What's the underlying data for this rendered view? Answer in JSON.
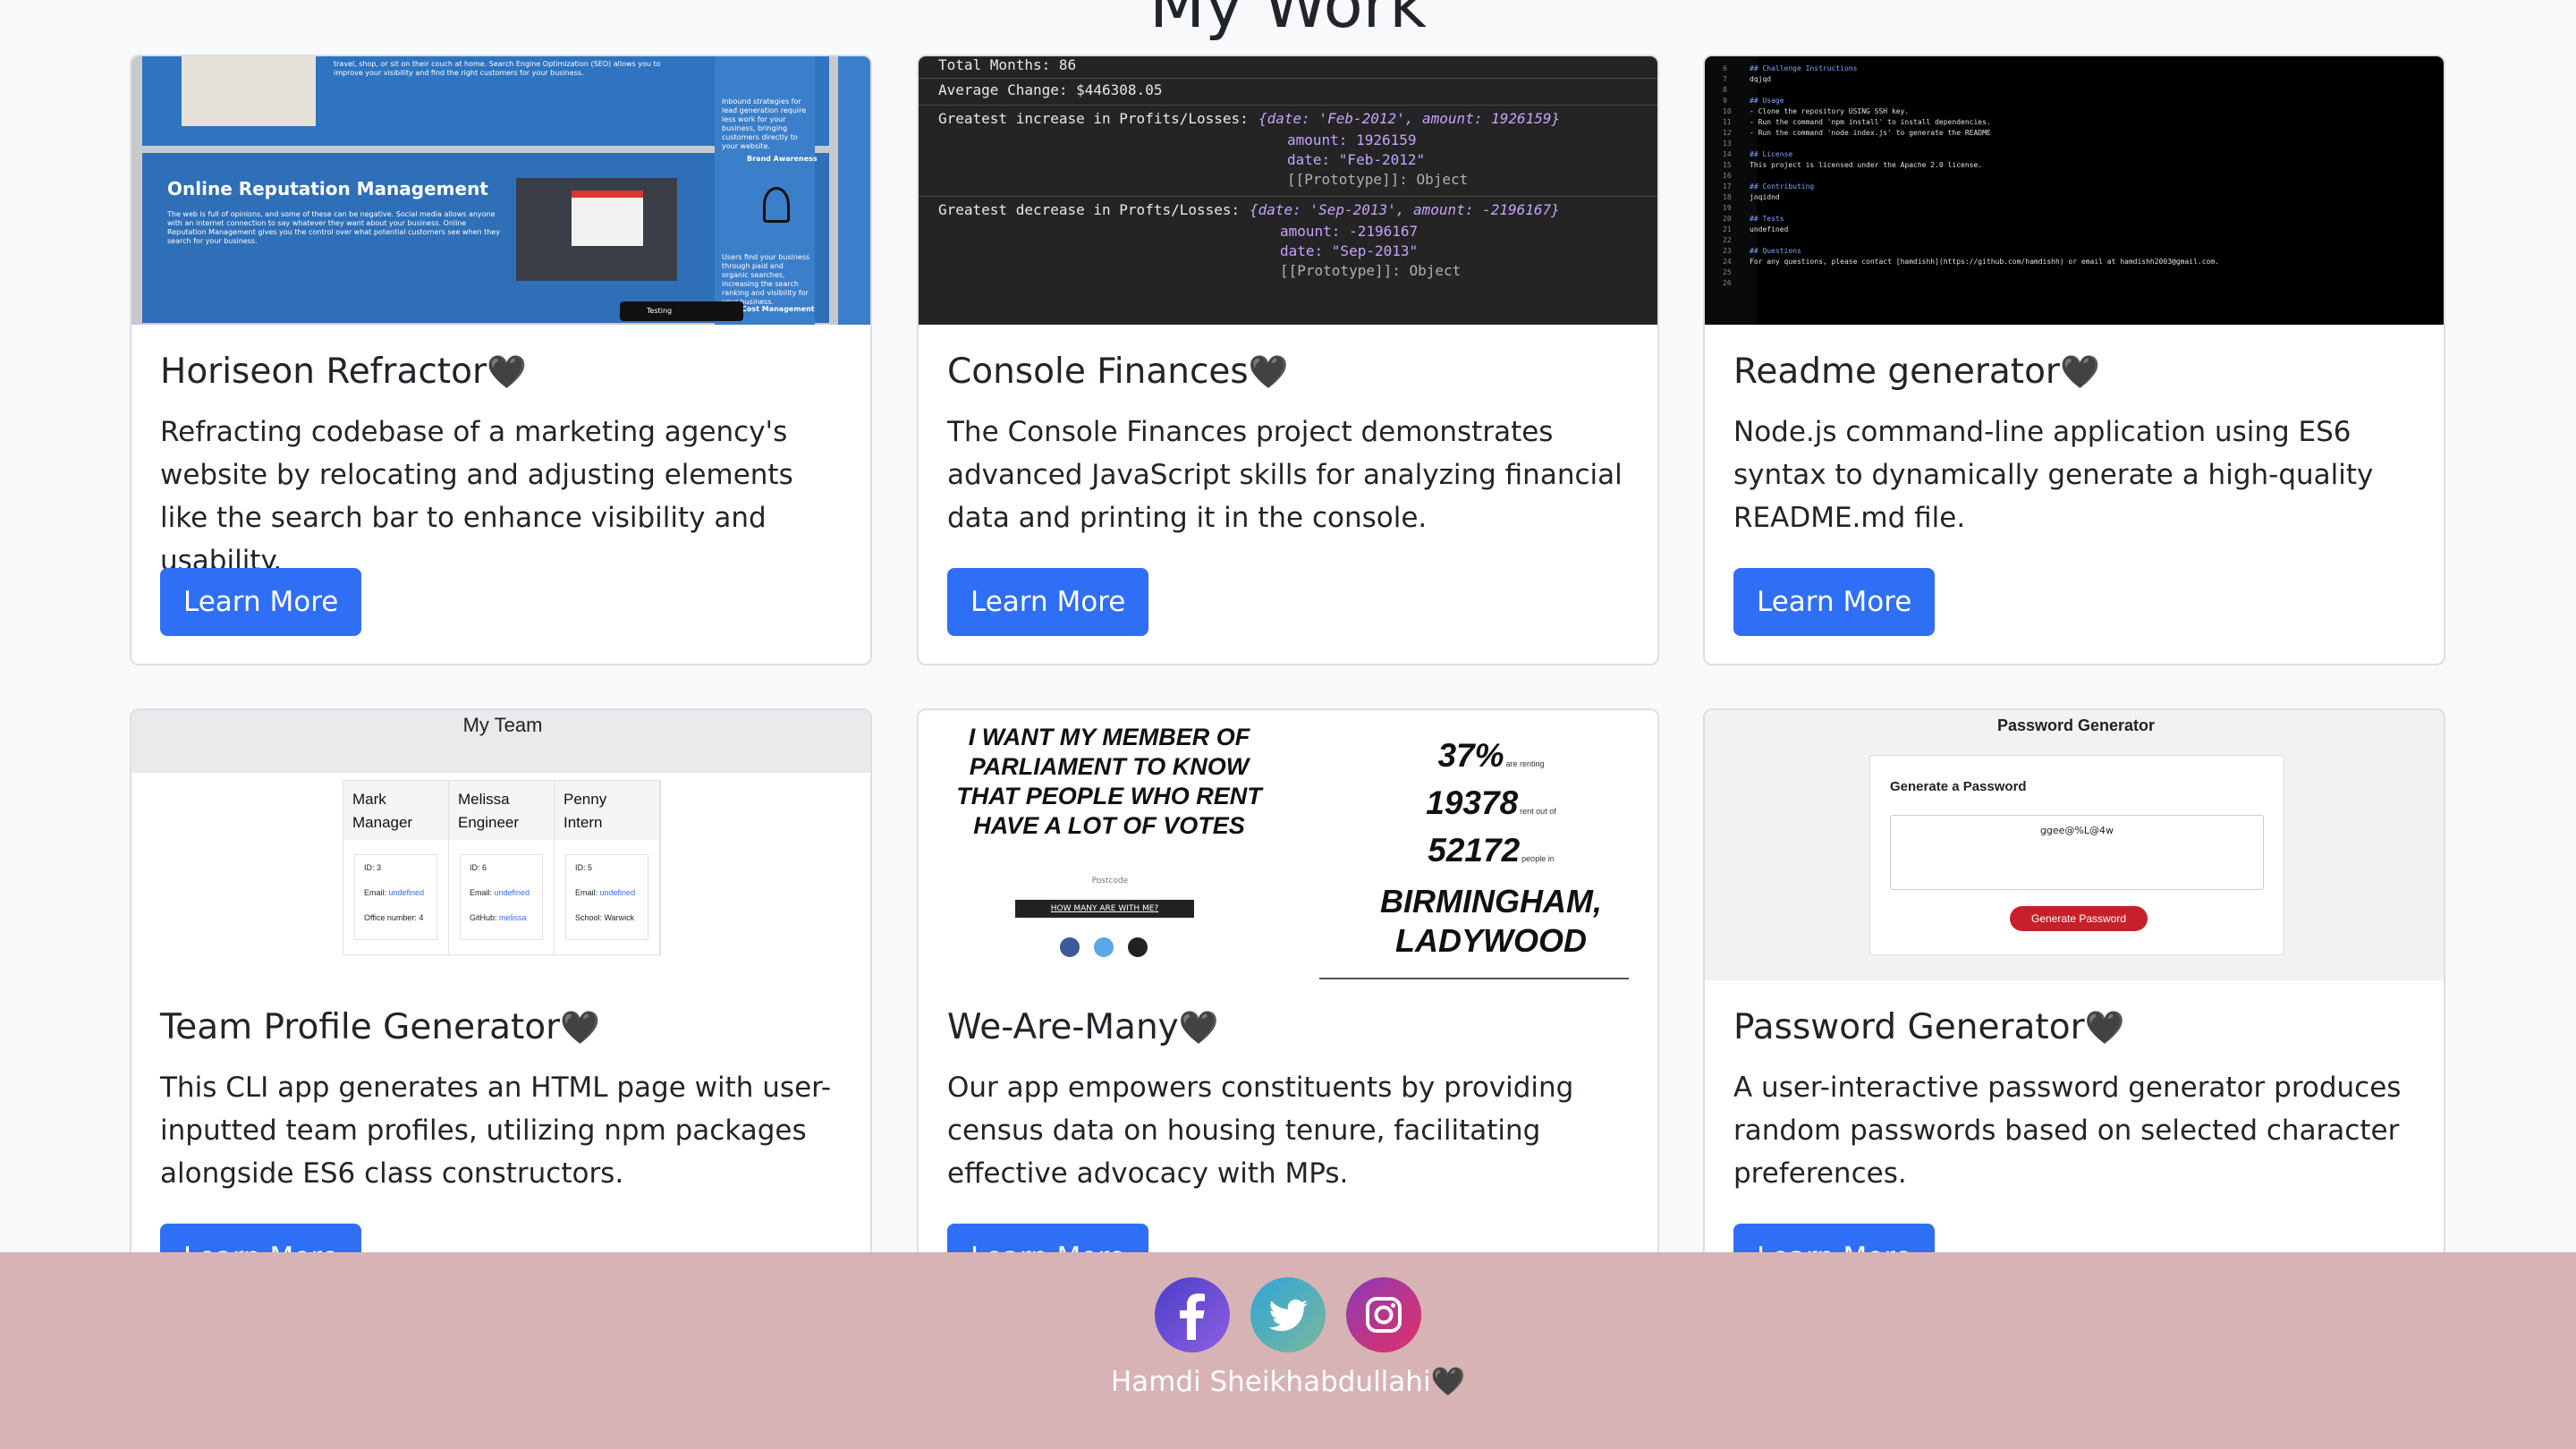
{
  "page": {
    "title": "My Work"
  },
  "colors": {
    "primary_button": "#2f6ff5",
    "footer_bg": "#d8b3b5",
    "card_border": "#dcdfe3"
  },
  "heart_glyph": "🖤",
  "projects": [
    {
      "title": "Horiseon Refractor",
      "description": "Refracting codebase of a marketing agency's website by relocating and adjusting elements like the search bar to enhance visibility and usability.",
      "button": "Learn More",
      "thumb": {
        "heading": "Online Reputation Management",
        "seo_text": "travel, shop, or sit on their couch at home. Search Engine Optimization (SEO) allows you to improve your visibility and find the right customers for your business.",
        "body_text": "The web is full of opinions, and some of these can be negative. Social media allows anyone with an internet connection to say whatever they want about your business. Online Reputation Management gives you the control over what potential customers see when they search for your business.",
        "side_text_1": "Inbound strategies for lead generation require less work for your business, bringing customers directly to your website.",
        "side_heading_1": "Brand Awareness",
        "side_text_2": "Users find your business through paid and organic searches, increasing the search ranking and visibility for your business.",
        "side_heading_2": "Cost Management",
        "tab_label": "Testing"
      }
    },
    {
      "title": "Console Finances",
      "description": "The Console Finances project demonstrates advanced JavaScript skills for analyzing financial data and printing it in the console.",
      "button": "Learn More",
      "thumb": {
        "lines": [
          "Total Months: 86",
          "Average Change: $446308.05",
          "Greatest increase in Profits/Losses:",
          "{date: 'Feb-2012', amount: 1926159}",
          "amount: 1926159",
          "date: \"Feb-2012\"",
          "[[Prototype]]: Object",
          "Greatest decrease in Profts/Losses:",
          "{date: 'Sep-2013', amount: -2196167}",
          "amount: -2196167",
          "date: \"Sep-2013\"",
          "[[Prototype]]: Object"
        ]
      }
    },
    {
      "title": "Readme generator",
      "description": "Node.js command-line application using ES6 syntax to dynamically generate a high-quality README.md file.",
      "button": "Learn More",
      "thumb": {
        "lines": [
          "## Challenge Instructions",
          "dqjqd",
          "",
          "## Usage",
          "- Clone the repository USING SSH key.",
          "- Run the command 'npm install' to install dependencies.",
          "- Run the command 'node index.js' to generate the README",
          "",
          "## License",
          "This project is licensed under the Apache 2.0 license.",
          "",
          "## Contributing",
          "jnqidnd",
          "",
          "## Tests",
          "undefined",
          "",
          "## Questions",
          "For any questions, please contact [hamdishh](https://github.com/hamdishh) or email at hamdishh2003@gmail.com.",
          ""
        ],
        "line_numbers": [
          "6",
          "7",
          "8",
          "9",
          "10",
          "11",
          "12",
          "13",
          "14",
          "15",
          "16",
          "17",
          "18",
          "19",
          "20",
          "21",
          "22",
          "23",
          "24",
          "25",
          "26"
        ]
      }
    },
    {
      "title": "Team Profile Generator",
      "description": "This CLI app generates an HTML page with user-inputted team profiles, utilizing npm packages alongside ES6 class constructors.",
      "button": "Learn More",
      "thumb": {
        "header": "My Team",
        "members": [
          {
            "name": "Mark",
            "role": "Manager",
            "id": "ID: 3",
            "email": "undefined",
            "extra_label": "Office number: 4",
            "extra_value": ""
          },
          {
            "name": "Melissa",
            "role": "Engineer",
            "id": "ID: 6",
            "email": "undefined",
            "extra_label": "GitHub:",
            "extra_value": "melissa"
          },
          {
            "name": "Penny",
            "role": "Intern",
            "id": "ID: 5",
            "email": "undefined",
            "extra_label": "School: Warwick",
            "extra_value": ""
          }
        ],
        "email_label": "Email:"
      }
    },
    {
      "title": "We-Are-Many",
      "description": "Our app empowers constituents by providing census data on housing tenure, facilitating effective advocacy with MPs.",
      "button": "Learn More",
      "thumb": {
        "headline": "I WANT MY MEMBER OF PARLIAMENT TO KNOW THAT PEOPLE WHO RENT HAVE A LOT OF VOTES",
        "postcode_placeholder": "Postcode",
        "cta": "HOW MANY ARE WITH ME?",
        "stats": [
          {
            "value": "37%",
            "label": "are renting"
          },
          {
            "value": "19378",
            "label": "rent out of"
          },
          {
            "value": "52172",
            "label": "people in"
          }
        ],
        "constituency": "BIRMINGHAM, LADYWOOD"
      }
    },
    {
      "title": "Password Generator",
      "description": "A user-interactive password generator produces random passwords based on selected character preferences.",
      "button": "Learn More",
      "thumb": {
        "header": "Password Generator",
        "card_title": "Generate a Password",
        "password": "ggee@%L@4w",
        "button": "Generate Password"
      }
    }
  ],
  "footer": {
    "name": "Hamdi Sheikhabdullahi",
    "social": [
      {
        "icon": "facebook-icon",
        "color": "#5b4fd6"
      },
      {
        "icon": "twitter-icon",
        "color": "#3aa0c9"
      },
      {
        "icon": "instagram-icon",
        "color": "#c13584"
      }
    ]
  }
}
